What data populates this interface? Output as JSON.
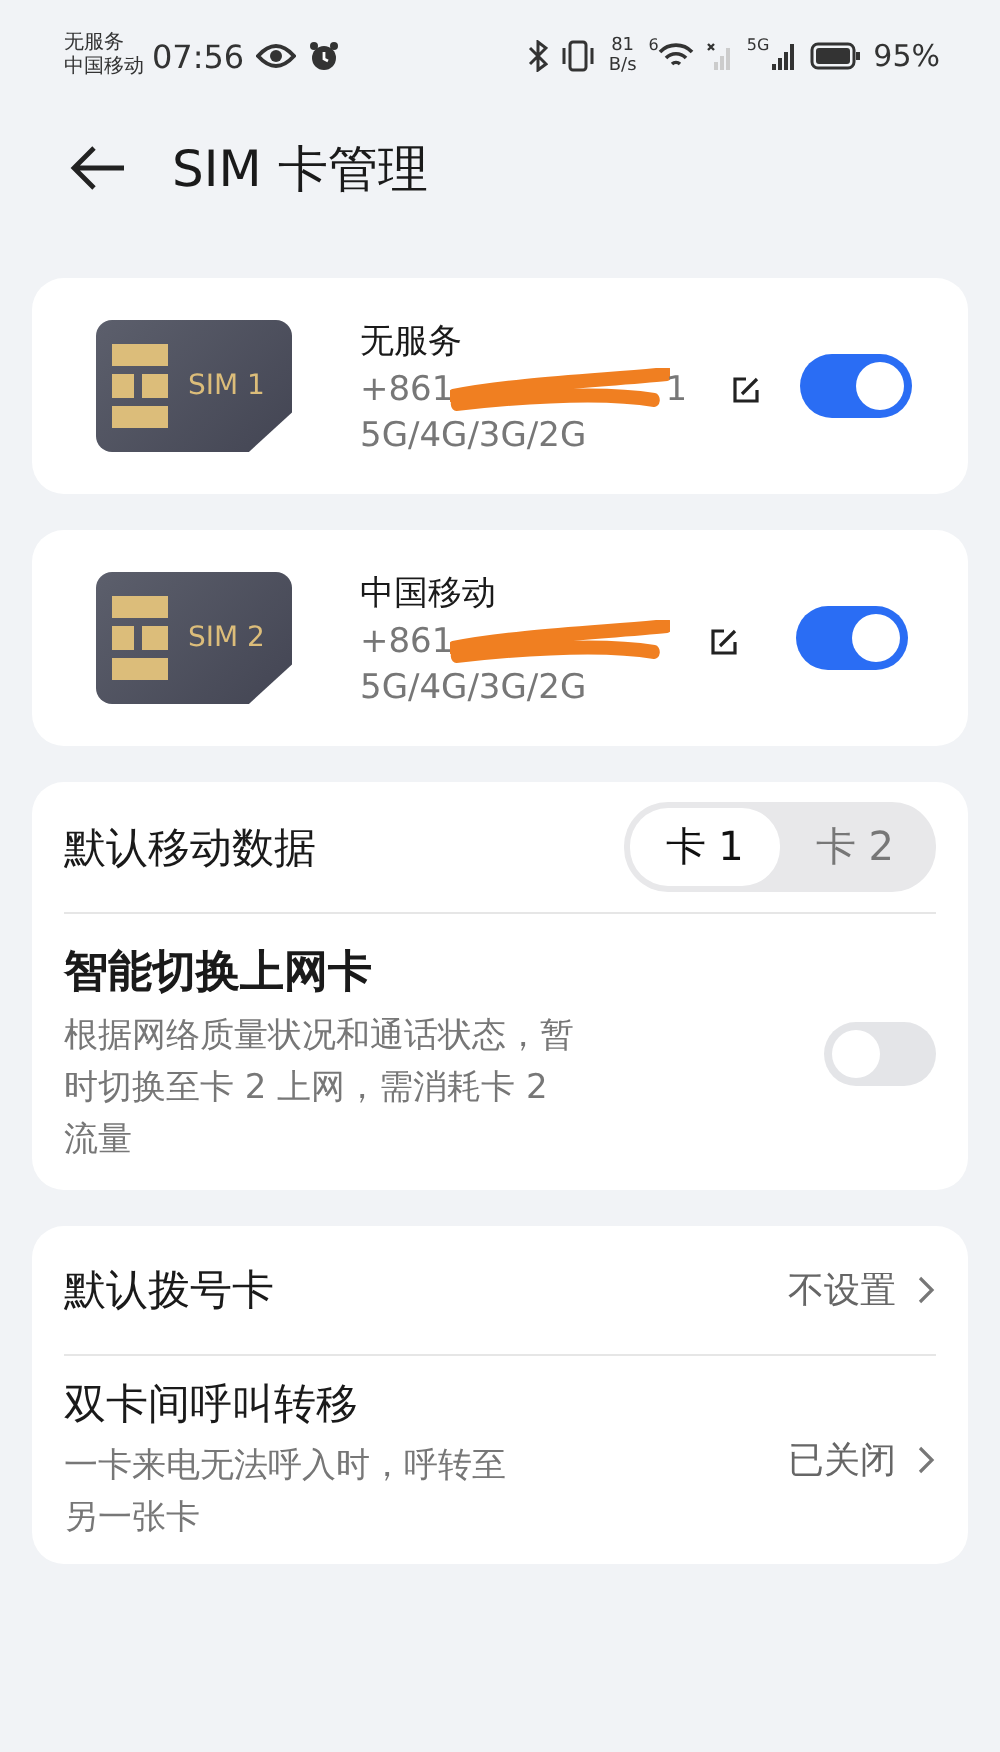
{
  "status_bar": {
    "carrier_1": "无服务",
    "carrier_2": "中国移动",
    "time": "07:56",
    "speed_value": "81",
    "speed_unit": "B/s",
    "wifi_badge": "6",
    "signal_badge": "5G",
    "battery": "95%"
  },
  "header": {
    "title": "SIM 卡管理"
  },
  "sim_cards": [
    {
      "chip_label": "SIM 1",
      "name": "无服务",
      "number": "+861",
      "number_tail": "1",
      "networks": "5G/4G/3G/2G",
      "on": true
    },
    {
      "chip_label": "SIM 2",
      "name": "中国移动",
      "number": "+861",
      "networks": "5G/4G/3G/2G",
      "on": true
    }
  ],
  "data_settings": {
    "default_data_label": "默认移动数据",
    "segments": [
      {
        "label": "卡 1",
        "selected": true
      },
      {
        "label": "卡 2",
        "selected": false
      }
    ],
    "smart_switch": {
      "title": "智能切换上网卡",
      "description": "根据网络质量状况和通话状态，暂时切换至卡 2 上网，需消耗卡 2 流量",
      "on": false
    }
  },
  "call_settings": [
    {
      "title": "默认拨号卡",
      "value": "不设置"
    },
    {
      "title": "双卡间呼叫转移",
      "description": "一卡来电无法呼入时，呼转至另一张卡",
      "value": "已关闭"
    }
  ]
}
